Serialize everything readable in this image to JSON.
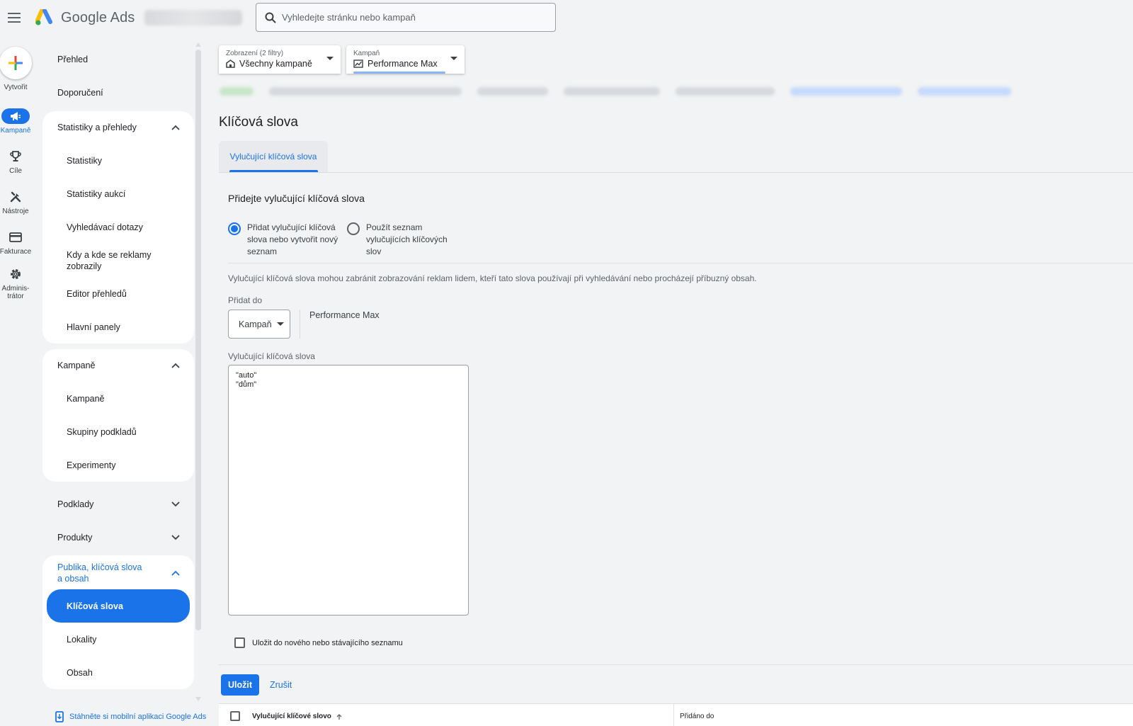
{
  "header": {
    "app_name": "Google Ads",
    "search_placeholder": "Vyhledejte stránku nebo kampaň"
  },
  "rail": {
    "create": "Vytvořit",
    "campaigns": "Kampaně",
    "goals": "Cíle",
    "tools": "Nástroje",
    "billing": "Fakturace",
    "admin_line1": "Adminis-",
    "admin_line2": "trátor"
  },
  "nav": {
    "overview": "Přehled",
    "recommendations": "Doporučení",
    "insights": {
      "label": "Statistiky a přehledy",
      "items": [
        "Statistiky",
        "Statistiky aukcí",
        "Vyhledávací dotazy",
        "Kdy a kde se reklamy zobrazily",
        "Editor přehledů",
        "Hlavní panely"
      ]
    },
    "campaigns": {
      "label": "Kampaně",
      "items": [
        "Kampaně",
        "Skupiny podkladů",
        "Experimenty"
      ]
    },
    "assets": "Podklady",
    "products": "Produkty",
    "audiences": {
      "label_line1": "Publika, klíčová slova",
      "label_line2": "a obsah",
      "items": [
        "Klíčová slova",
        "Lokality",
        "Obsah"
      ]
    },
    "footer_link": "Stáhněte si mobilní aplikaci Google Ads"
  },
  "filters": {
    "view_label": "Zobrazení (2 filtry)",
    "view_value": "Všechny kampaně",
    "campaign_label": "Kampaň",
    "campaign_value": "Performance Max"
  },
  "main": {
    "title": "Klíčová slova",
    "tab": "Vylučující klíčová slova",
    "section_title": "Přidejte vylučující klíčová slova",
    "option_new_line1": "Přidat vylučující klíčová",
    "option_new_line2": "slova nebo vytvořit nový",
    "option_new_line3": "seznam",
    "option_list_line1": "Použít seznam",
    "option_list_line2": "vylučujících klíčových",
    "option_list_line3": "slov",
    "description": "Vylučující klíčová slova mohou zabránit zobrazování reklam lidem, kteří tato slova používají při vyhledávání nebo procházejí příbuzný obsah.",
    "add_to_label": "Přidat do",
    "add_to_value": "Kampaň",
    "campaign_name": "Performance Max",
    "keywords_label": "Vylučující klíčová slova",
    "keywords_value": "\"auto\"\n\"dům\"",
    "save_list_label": "Uložit do nového nebo stávajícího seznamu",
    "save_button": "Uložit",
    "cancel_button": "Zrušit",
    "table_col_keyword": "Vylučující klíčové slovo",
    "table_col_added": "Přidáno do"
  },
  "colors": {
    "accent": "#1a73e8",
    "background": "#f1f3f4"
  }
}
